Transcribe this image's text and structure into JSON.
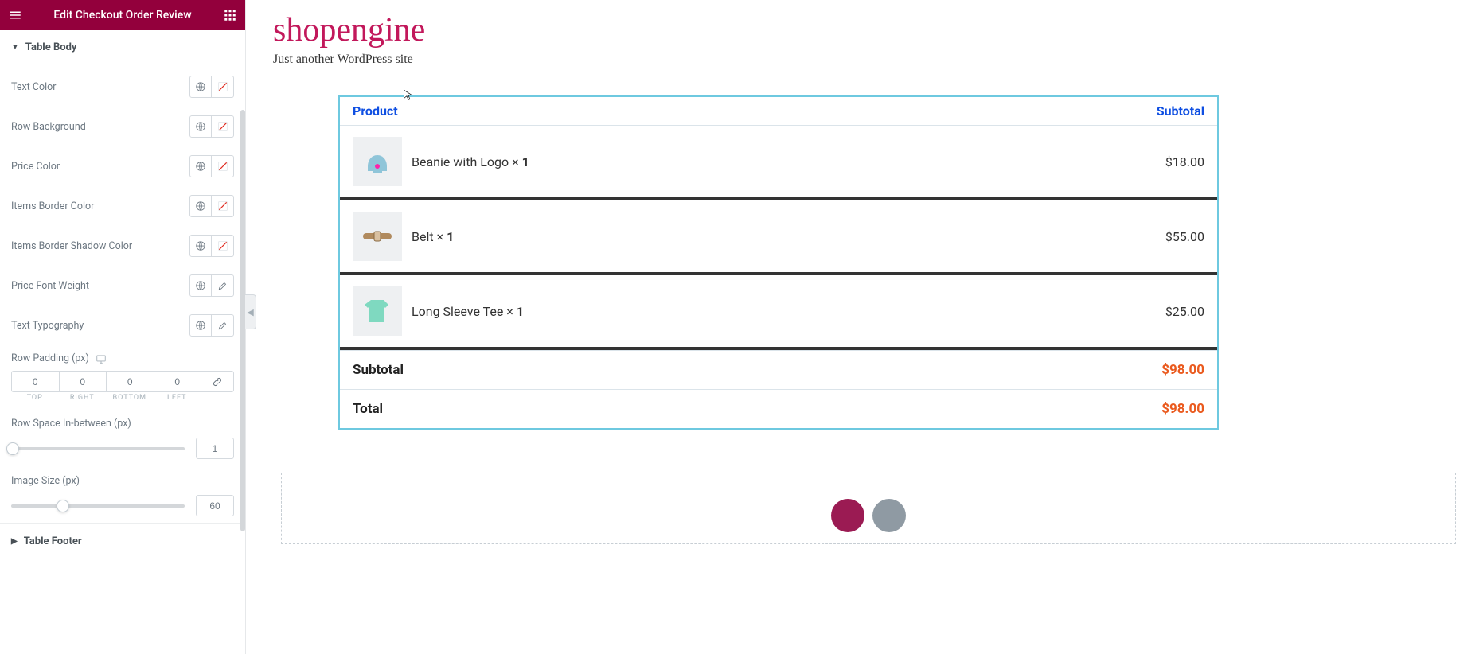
{
  "header": {
    "title": "Edit Checkout Order Review"
  },
  "sections": {
    "table_body_title": "Table Body",
    "table_footer_title": "Table Footer"
  },
  "panel": {
    "text_color": "Text Color",
    "row_background": "Row Background",
    "price_color": "Price Color",
    "items_border_color": "Items Border Color",
    "items_border_shadow_color": "Items Border Shadow Color",
    "price_font_weight": "Price Font Weight",
    "text_typography": "Text Typography",
    "row_padding_label": "Row Padding (px)",
    "row_space_label": "Row Space In-between (px)",
    "image_size_label": "Image Size (px)"
  },
  "padding": {
    "top": "0",
    "right": "0",
    "bottom": "0",
    "left": "0",
    "labels": {
      "top": "TOP",
      "right": "RIGHT",
      "bottom": "BOTTOM",
      "left": "LEFT"
    }
  },
  "sliders": {
    "row_space_value": "1",
    "image_size_value": "60"
  },
  "preview": {
    "site_title": "shopengine",
    "site_tagline": "Just another WordPress site",
    "col_product": "Product",
    "col_subtotal": "Subtotal",
    "items": [
      {
        "name": "Beanie with Logo",
        "qty": "1",
        "price": "$18.00"
      },
      {
        "name": "Belt",
        "qty": "1",
        "price": "$55.00"
      },
      {
        "name": "Long Sleeve Tee",
        "qty": "1",
        "price": "$25.00"
      }
    ],
    "subtotal_label": "Subtotal",
    "subtotal_value": "$98.00",
    "total_label": "Total",
    "total_value": "$98.00"
  }
}
